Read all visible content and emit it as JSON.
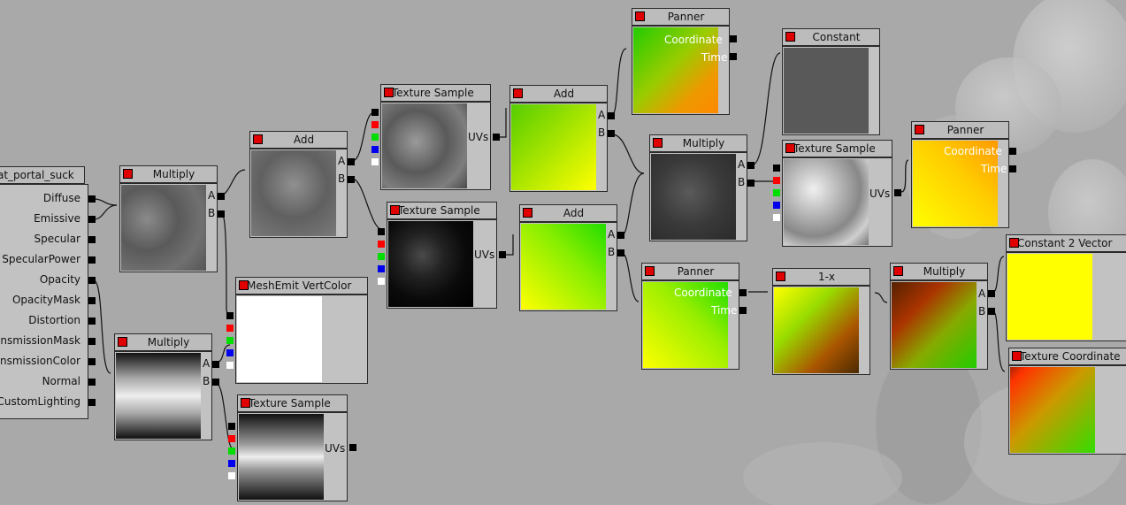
{
  "root": {
    "title": "at_portal_suck",
    "inputs": [
      "Diffuse",
      "Emissive",
      "Specular",
      "SpecularPower",
      "Opacity",
      "OpacityMask",
      "Distortion",
      "ansmissionMask",
      "ansmissionColor",
      "Normal",
      "CustomLighting"
    ]
  },
  "nodes": {
    "multiply1": {
      "title": "Multiply",
      "pins": [
        "A",
        "B"
      ]
    },
    "multiply2": {
      "title": "Multiply",
      "pins": [
        "A",
        "B"
      ]
    },
    "add1": {
      "title": "Add",
      "pins": [
        "A",
        "B"
      ]
    },
    "meshemit": {
      "title": "MeshEmit VertColor"
    },
    "texsample3": {
      "title": "Texture Sample",
      "uvs": "UVs"
    },
    "texsample1": {
      "title": "Texture Sample",
      "uvs": "UVs"
    },
    "texsample2": {
      "title": "Texture Sample",
      "uvs": "UVs"
    },
    "add2": {
      "title": "Add",
      "pins": [
        "A",
        "B"
      ]
    },
    "add3": {
      "title": "Add",
      "pins": [
        "A",
        "B"
      ]
    },
    "panner1": {
      "title": "Panner",
      "coordinate": "Coordinate",
      "time": "Time"
    },
    "multiply3": {
      "title": "Multiply",
      "pins": [
        "A",
        "B"
      ]
    },
    "panner2": {
      "title": "Panner",
      "coordinate": "Coordinate",
      "time": "Time"
    },
    "constant": {
      "title": "Constant"
    },
    "texsample4": {
      "title": "Texture Sample",
      "uvs": "UVs"
    },
    "panner3": {
      "title": "Panner",
      "coordinate": "Coordinate",
      "time": "Time"
    },
    "oneminus": {
      "title": "1-x"
    },
    "multiply4": {
      "title": "Multiply",
      "pins": [
        "A",
        "B"
      ]
    },
    "constant2vector": {
      "title": "Constant 2 Vector"
    },
    "texcoord": {
      "title": "Texture Coordinate"
    }
  },
  "colors": {
    "canvas": "#a9a9a9",
    "node_frame": "#c2c2c2",
    "header": "#bcbcbc",
    "toggle": "#e00000",
    "constant_value": "#595959",
    "constant2vector_value": "#ffff00"
  }
}
